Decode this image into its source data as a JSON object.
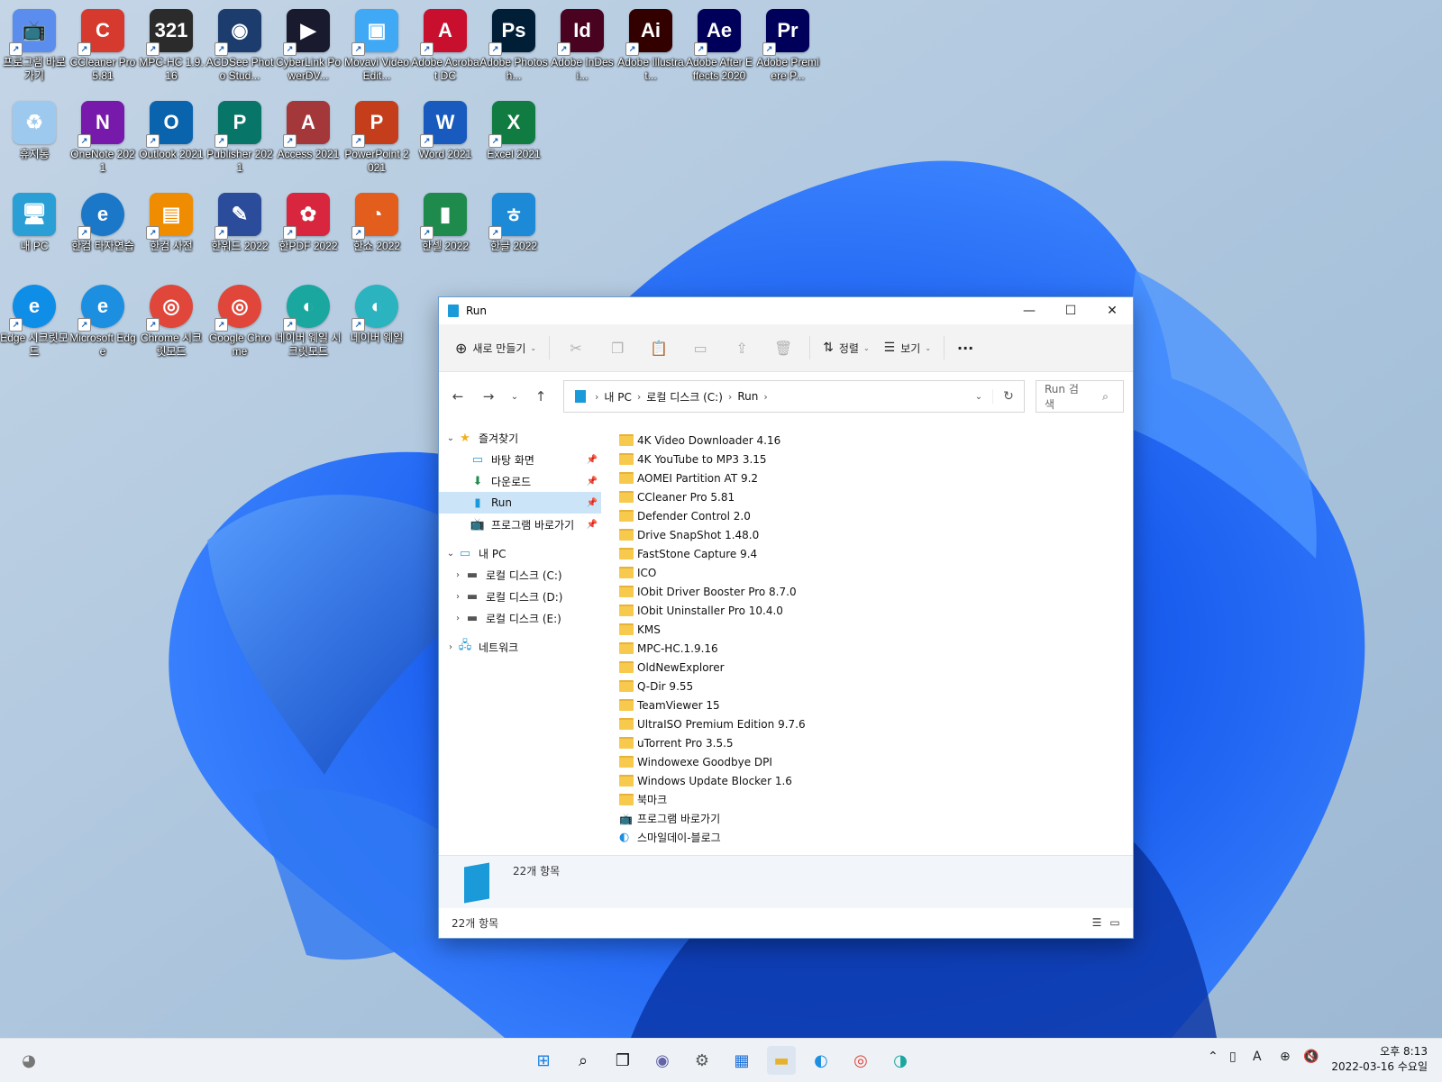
{
  "desktop": {
    "icons": [
      {
        "label": "프로그램 바로가기",
        "glyph": "📺",
        "color": "#5b8def",
        "icon": "tv-icon"
      },
      {
        "label": "CCleaner Pro 5.81",
        "glyph": "C",
        "color": "#d63a2f",
        "icon": "ccleaner-icon"
      },
      {
        "label": "MPC-HC 1.9.16",
        "glyph": "321",
        "color": "#2b2b2b",
        "icon": "mpc-hc-icon"
      },
      {
        "label": "ACDSee Photo Stud...",
        "glyph": "◉",
        "color": "#1d3c6e",
        "icon": "acdsee-icon"
      },
      {
        "label": "CyberLink PowerDV...",
        "glyph": "▶",
        "color": "#1a1a2e",
        "icon": "powerdirector-icon"
      },
      {
        "label": "Movavi Video Edit...",
        "glyph": "▣",
        "color": "#3fa9f5",
        "icon": "movavi-icon"
      },
      {
        "label": "Adobe Acrobat DC",
        "glyph": "A",
        "color": "#c8102e",
        "icon": "acrobat-icon"
      },
      {
        "label": "Adobe Photosh...",
        "glyph": "Ps",
        "color": "#001e36",
        "icon": "photoshop-icon"
      },
      {
        "label": "Adobe InDesi...",
        "glyph": "Id",
        "color": "#49021f",
        "icon": "indesign-icon"
      },
      {
        "label": "Adobe Illustrat...",
        "glyph": "Ai",
        "color": "#330000",
        "icon": "illustrator-icon"
      },
      {
        "label": "Adobe After Effects 2020",
        "glyph": "Ae",
        "color": "#00005b",
        "icon": "after-effects-icon"
      },
      {
        "label": "Adobe Premiere P...",
        "glyph": "Pr",
        "color": "#00005b",
        "icon": "premiere-icon"
      },
      {
        "label": "휴지통",
        "glyph": "♻",
        "color": "#9ec9ee",
        "icon": "recycle-bin-icon"
      },
      {
        "label": "OneNote 2021",
        "glyph": "N",
        "color": "#7719aa",
        "icon": "onenote-icon"
      },
      {
        "label": "Outlook 2021",
        "glyph": "O",
        "color": "#0a64ad",
        "icon": "outlook-icon"
      },
      {
        "label": "Publisher 2021",
        "glyph": "P",
        "color": "#077568",
        "icon": "publisher-icon"
      },
      {
        "label": "Access 2021",
        "glyph": "A",
        "color": "#a4373a",
        "icon": "access-icon"
      },
      {
        "label": "PowerPoint 2021",
        "glyph": "P",
        "color": "#c43e1c",
        "icon": "powerpoint-icon"
      },
      {
        "label": "Word 2021",
        "glyph": "W",
        "color": "#185abd",
        "icon": "word-icon"
      },
      {
        "label": "Excel 2021",
        "glyph": "X",
        "color": "#107c41",
        "icon": "excel-icon"
      },
      {
        "label": "내 PC",
        "glyph": "🖥",
        "color": "#2a9fd6",
        "icon": "this-pc-icon"
      },
      {
        "label": "한컴 타자연습",
        "glyph": "e",
        "color": "#1b78c9",
        "icon": "hancom-typing-icon"
      },
      {
        "label": "한컴 사전",
        "glyph": "▤",
        "color": "#f08c00",
        "icon": "hancom-dictionary-icon"
      },
      {
        "label": "한워드 2022",
        "glyph": "✎",
        "color": "#2b4c9b",
        "icon": "hanword-icon"
      },
      {
        "label": "한PDF 2022",
        "glyph": "✿",
        "color": "#d7263d",
        "icon": "hanpdf-icon"
      },
      {
        "label": "한쇼 2022",
        "glyph": "◔",
        "color": "#e35d1c",
        "icon": "hanshow-icon"
      },
      {
        "label": "한셀 2022",
        "glyph": "▮",
        "color": "#1e8a4c",
        "icon": "hancell-icon"
      },
      {
        "label": "한글 2022",
        "glyph": "ㅎ",
        "color": "#1c8ad6",
        "icon": "hangul-icon"
      },
      {
        "label": "Edge 시크릿모드",
        "glyph": "e",
        "color": "#0f8ee8",
        "icon": "edge-inprivate-icon"
      },
      {
        "label": "Microsoft Edge",
        "glyph": "e",
        "color": "#1d8fe0",
        "icon": "edge-icon"
      },
      {
        "label": "Chrome 시크릿모드",
        "glyph": "◎",
        "color": "#e0463a",
        "icon": "chrome-incognito-icon"
      },
      {
        "label": "Google Chrome",
        "glyph": "◎",
        "color": "#e0463a",
        "icon": "chrome-icon"
      },
      {
        "label": "네이버 웨일 시크릿모드",
        "glyph": "◐",
        "color": "#1aa7a0",
        "icon": "whale-secret-icon"
      },
      {
        "label": "네이버 웨일",
        "glyph": "◐",
        "color": "#2bb3c0",
        "icon": "whale-icon"
      }
    ]
  },
  "explorer": {
    "title": "Run",
    "toolbar": {
      "new": "새로 만들기",
      "sort": "정렬",
      "view": "보기",
      "more": "···"
    },
    "address": {
      "crumbs": [
        "내 PC",
        "로컬 디스크 (C:)",
        "Run"
      ],
      "search_placeholder": "Run 검색"
    },
    "nav": {
      "favorites": "즐겨찾기",
      "fav_items": [
        {
          "label": "바탕 화면",
          "icon": "desktop-icon",
          "glyph": "▭",
          "color": "#1a9ad9"
        },
        {
          "label": "다운로드",
          "icon": "download-icon",
          "glyph": "⬇",
          "color": "#1e8a4c"
        },
        {
          "label": "Run",
          "icon": "folder-run-icon",
          "glyph": "▮",
          "color": "#1a9ad9"
        },
        {
          "label": "프로그램 바로가기",
          "icon": "tv-icon",
          "glyph": "📺",
          "color": "#1a6fd8"
        }
      ],
      "this_pc": "내 PC",
      "drives": [
        "로컬 디스크 (C:)",
        "로컬 디스크 (D:)",
        "로컬 디스크 (E:)"
      ],
      "network": "네트워크"
    },
    "files": [
      {
        "name": "4K Video Downloader 4.16",
        "type": "folder"
      },
      {
        "name": "4K YouTube to MP3 3.15",
        "type": "folder"
      },
      {
        "name": "AOMEI Partition AT 9.2",
        "type": "folder"
      },
      {
        "name": "CCleaner Pro 5.81",
        "type": "folder"
      },
      {
        "name": "Defender Control 2.0",
        "type": "folder"
      },
      {
        "name": "Drive SnapShot 1.48.0",
        "type": "folder"
      },
      {
        "name": "FastStone Capture 9.4",
        "type": "folder"
      },
      {
        "name": "ICO",
        "type": "folder"
      },
      {
        "name": "IObit Driver Booster Pro 8.7.0",
        "type": "folder"
      },
      {
        "name": "IObit Uninstaller Pro 10.4.0",
        "type": "folder"
      },
      {
        "name": "KMS",
        "type": "folder"
      },
      {
        "name": "MPC-HC.1.9.16",
        "type": "folder"
      },
      {
        "name": "OldNewExplorer",
        "type": "folder"
      },
      {
        "name": "Q-Dir 9.55",
        "type": "folder"
      },
      {
        "name": "TeamViewer 15",
        "type": "folder"
      },
      {
        "name": "UltraISO Premium Edition 9.7.6",
        "type": "folder"
      },
      {
        "name": "uTorrent Pro 3.5.5",
        "type": "folder"
      },
      {
        "name": "Windowexe Goodbye DPI",
        "type": "folder"
      },
      {
        "name": "Windows Update Blocker 1.6",
        "type": "folder"
      },
      {
        "name": "북마크",
        "type": "folder"
      },
      {
        "name": "프로그램 바로가기",
        "type": "tv-shortcut"
      },
      {
        "name": "스마일데이-블로그",
        "type": "edge-shortcut"
      }
    ],
    "details_count": "22개 항목",
    "status_count": "22개 항목"
  },
  "taskbar": {
    "clock_time": "오후 8:13",
    "clock_date": "2022-03-16 수요일"
  },
  "colors": {
    "accent": "#1a9ad9",
    "selection": "#cce4f7",
    "folder": "#f7c94d"
  }
}
